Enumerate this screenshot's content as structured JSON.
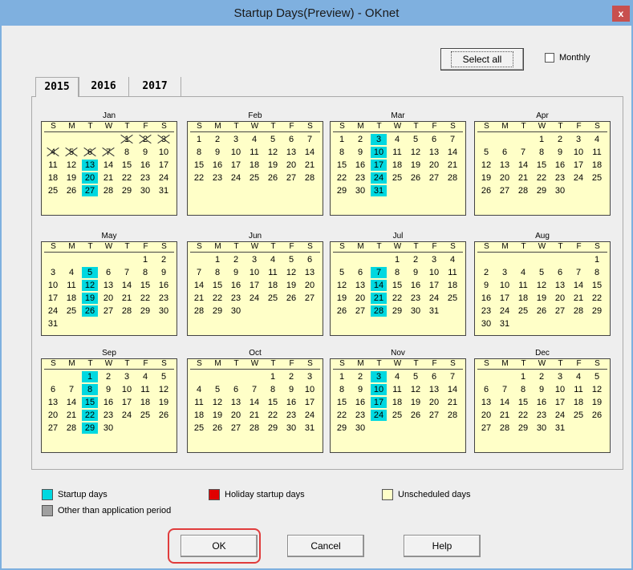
{
  "window": {
    "title": "Startup Days(Preview) - OKnet",
    "close_label": "x"
  },
  "toolbar": {
    "select_all_label": "Select all",
    "monthly_label": "Monthly",
    "monthly_checked": false
  },
  "tabs": [
    "2015",
    "2016",
    "2017"
  ],
  "active_tab": "2015",
  "dow_labels": [
    "S",
    "M",
    "T",
    "W",
    "T",
    "F",
    "S"
  ],
  "months": [
    {
      "name": "Jan",
      "first_weekday": 4,
      "days": 31,
      "startup": [
        13,
        20,
        27
      ],
      "out_of_period": [
        1,
        2,
        3,
        4,
        5,
        6,
        7
      ]
    },
    {
      "name": "Feb",
      "first_weekday": 0,
      "days": 28,
      "startup": [],
      "out_of_period": []
    },
    {
      "name": "Mar",
      "first_weekday": 0,
      "days": 31,
      "startup": [
        3,
        10,
        17,
        24,
        31
      ],
      "out_of_period": []
    },
    {
      "name": "Apr",
      "first_weekday": 3,
      "days": 30,
      "startup": [],
      "out_of_period": []
    },
    {
      "name": "May",
      "first_weekday": 5,
      "days": 31,
      "startup": [
        5,
        12,
        19,
        26
      ],
      "out_of_period": []
    },
    {
      "name": "Jun",
      "first_weekday": 1,
      "days": 30,
      "startup": [],
      "out_of_period": []
    },
    {
      "name": "Jul",
      "first_weekday": 3,
      "days": 31,
      "startup": [
        7,
        14,
        21,
        28
      ],
      "out_of_period": []
    },
    {
      "name": "Aug",
      "first_weekday": 6,
      "days": 31,
      "startup": [],
      "out_of_period": []
    },
    {
      "name": "Sep",
      "first_weekday": 2,
      "days": 30,
      "startup": [
        1,
        8,
        15,
        22,
        29
      ],
      "out_of_period": []
    },
    {
      "name": "Oct",
      "first_weekday": 4,
      "days": 31,
      "startup": [],
      "out_of_period": []
    },
    {
      "name": "Nov",
      "first_weekday": 0,
      "days": 30,
      "startup": [
        3,
        10,
        17,
        24
      ],
      "out_of_period": []
    },
    {
      "name": "Dec",
      "first_weekday": 2,
      "days": 31,
      "startup": [],
      "out_of_period": []
    }
  ],
  "legend": {
    "startup": "Startup days",
    "holiday_startup": "Holiday startup days",
    "unscheduled": "Unscheduled days",
    "other": "Other than application period"
  },
  "colors": {
    "startup": "#00d8e0",
    "holiday": "#e00000",
    "unscheduled": "#ffffc8",
    "other": "#a0a0a0"
  },
  "buttons": {
    "ok": "OK",
    "cancel": "Cancel",
    "help": "Help"
  }
}
